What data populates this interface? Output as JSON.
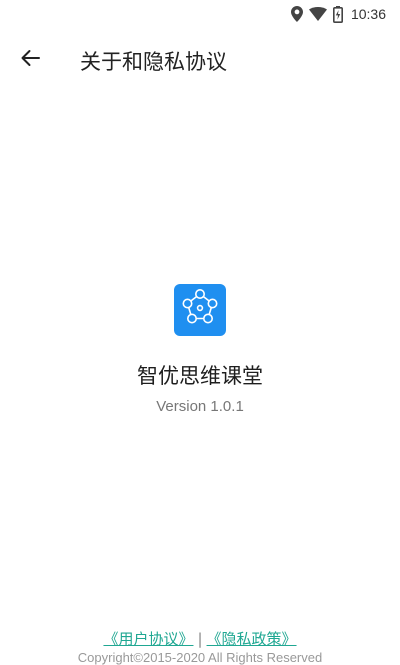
{
  "status_bar": {
    "time": "10:36",
    "icons": [
      "location-icon",
      "wifi-icon",
      "battery-icon"
    ]
  },
  "app_bar": {
    "back_icon": "arrow-left-icon",
    "title": "关于和隐私协议"
  },
  "about": {
    "logo_icon": "pentagon-network-logo",
    "app_name": "智优思维课堂",
    "version": "Version 1.0.1"
  },
  "footer": {
    "user_agreement": "《用户协议》",
    "separator": "|",
    "privacy_policy": "《隐私政策》",
    "copyright": "Copyright©2015-2020 All Rights Reserved"
  },
  "colors": {
    "logo_bg": "#1f8ff0",
    "link": "#1fa792"
  }
}
